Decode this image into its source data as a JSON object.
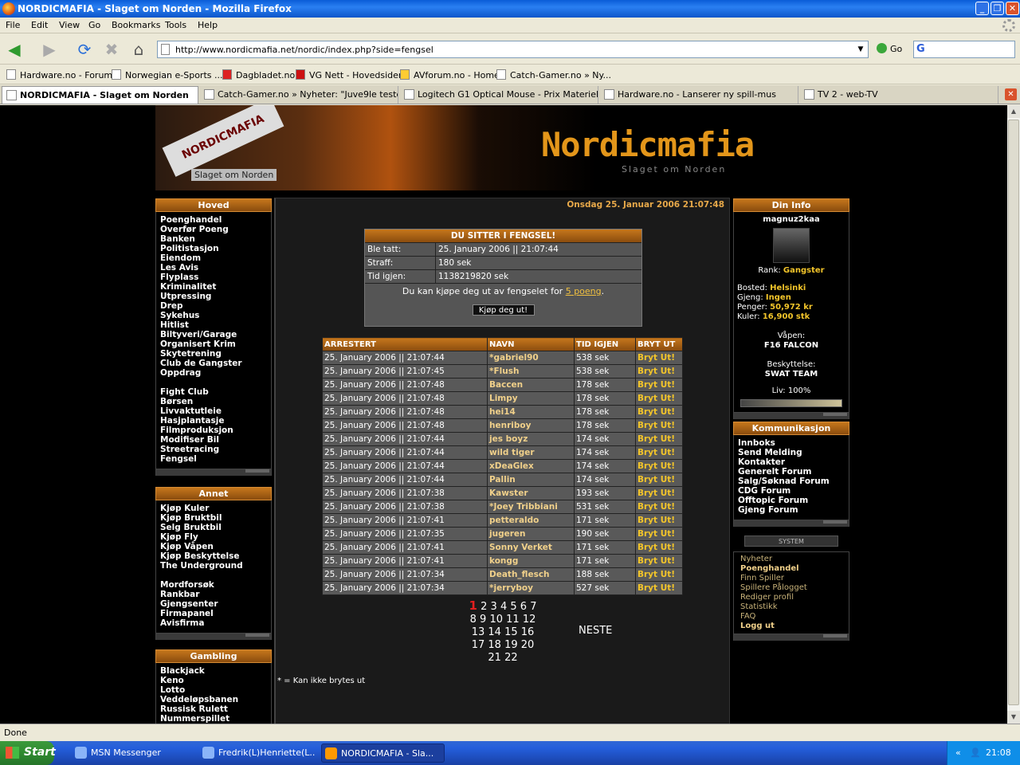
{
  "window": {
    "title": "NORDICMAFIA - Slaget om Norden - Mozilla Firefox"
  },
  "menu": [
    "File",
    "Edit",
    "View",
    "Go",
    "Bookmarks",
    "Tools",
    "Help"
  ],
  "nav": {
    "url": "http://www.nordicmafia.net/nordic/index.php?side=fengsel",
    "go_label": "Go"
  },
  "bookmarks": [
    "Hardware.no - Forum",
    "Norwegian e-Sports ...",
    "Dagbladet.no",
    "VG Nett - Hovedsiden",
    "AVforum.no - Home",
    "Catch-Gamer.no » Ny..."
  ],
  "tabs": [
    "NORDICMAFIA - Slaget om Norden",
    "Catch-Gamer.no » Nyheter: \"Juve9le tester...",
    "Logitech G1 Optical Mouse - Prix Materiel .com",
    "Hardware.no - Lanserer ny spill-mus",
    "TV 2 - web-TV"
  ],
  "status": "Done",
  "taskbar": {
    "start": "Start",
    "tasks": [
      "MSN Messenger",
      "Fredrik(L)Henriette(L...",
      "NORDICMAFIA - Sla..."
    ],
    "clock": "21:08"
  },
  "banner": {
    "ribbon": "NORDICMAFIA",
    "slogan1": "Slaget om Norden",
    "logo": "Nordicmafia",
    "slogan2": "Slaget om Norden"
  },
  "sidebar": {
    "hoved": {
      "title": "Hoved",
      "items1": [
        "Poenghandel",
        "Overfør Poeng",
        "Banken",
        "Politistasjon",
        "Eiendom",
        "Les Avis",
        "Flyplass",
        "Kriminalitet",
        "Utpressing",
        "Drep",
        "Sykehus",
        "Hitlist",
        "Biltyveri/Garage",
        "Organisert Krim",
        "Skytetrening",
        "Club de Gangster",
        "Oppdrag"
      ],
      "items2": [
        "Fight Club",
        "Børsen",
        "Livvaktutleie",
        "Hasjplantasje",
        "Filmproduksjon",
        "Modifiser Bil",
        "Streetracing",
        "Fengsel"
      ]
    },
    "annet": {
      "title": "Annet",
      "items1": [
        "Kjøp Kuler",
        "Kjøp Bruktbil",
        "Selg Bruktbil",
        "Kjøp Fly",
        "Kjøp Våpen",
        "Kjøp Beskyttelse",
        "The Underground"
      ],
      "items2": [
        "Mordforsøk",
        "Rankbar",
        "Gjengsenter",
        "Firmapanel",
        "Avisfirma"
      ]
    },
    "gambling": {
      "title": "Gambling",
      "items": [
        "Blackjack",
        "Keno",
        "Lotto",
        "Veddeløpsbanen",
        "Russisk Rulett",
        "Nummerspillet"
      ]
    }
  },
  "main": {
    "date": "Onsdag 25. Januar 2006 21:07:48",
    "jail": {
      "title": "DU SITTER I FENGSEL!",
      "rows": [
        [
          "Ble tatt:",
          "25. January 2006 || 21:07:44"
        ],
        [
          "Straff:",
          "180 sek"
        ],
        [
          "Tid igjen:",
          "1138219820 sek"
        ]
      ],
      "msg_prefix": "Du kan kjøpe deg ut av fengselet for ",
      "msg_link": "5 poeng",
      "msg_suffix": ".",
      "button": "Kjøp deg ut!"
    },
    "table": {
      "headers": [
        "ARRESTERT",
        "NAVN",
        "TID IGJEN",
        "BRYT UT"
      ],
      "rows": [
        [
          "25. January 2006 || 21:07:44",
          "*gabriel90",
          "538 sek",
          "Bryt Ut!"
        ],
        [
          "25. January 2006 || 21:07:45",
          "*Flush",
          "538 sek",
          "Bryt Ut!"
        ],
        [
          "25. January 2006 || 21:07:48",
          "Baccen",
          "178 sek",
          "Bryt Ut!"
        ],
        [
          "25. January 2006 || 21:07:48",
          "Limpy",
          "178 sek",
          "Bryt Ut!"
        ],
        [
          "25. January 2006 || 21:07:48",
          "hei14",
          "178 sek",
          "Bryt Ut!"
        ],
        [
          "25. January 2006 || 21:07:48",
          "henriboy",
          "178 sek",
          "Bryt Ut!"
        ],
        [
          "25. January 2006 || 21:07:44",
          "jes boyz",
          "174 sek",
          "Bryt Ut!"
        ],
        [
          "25. January 2006 || 21:07:44",
          "wild tiger",
          "174 sek",
          "Bryt Ut!"
        ],
        [
          "25. January 2006 || 21:07:44",
          "xDeaGlex",
          "174 sek",
          "Bryt Ut!"
        ],
        [
          "25. January 2006 || 21:07:44",
          "Pallin",
          "174 sek",
          "Bryt Ut!"
        ],
        [
          "25. January 2006 || 21:07:38",
          "Kawster",
          "193 sek",
          "Bryt Ut!"
        ],
        [
          "25. January 2006 || 21:07:38",
          "*Joey Tribbiani",
          "531 sek",
          "Bryt Ut!"
        ],
        [
          "25. January 2006 || 21:07:41",
          "petteraldo",
          "171 sek",
          "Bryt Ut!"
        ],
        [
          "25. January 2006 || 21:07:35",
          "jugeren",
          "190 sek",
          "Bryt Ut!"
        ],
        [
          "25. January 2006 || 21:07:41",
          "Sonny Verket",
          "171 sek",
          "Bryt Ut!"
        ],
        [
          "25. January 2006 || 21:07:41",
          "kongg",
          "171 sek",
          "Bryt Ut!"
        ],
        [
          "25. January 2006 || 21:07:34",
          "Death_flesch",
          "188 sek",
          "Bryt Ut!"
        ],
        [
          "25. January 2006 || 21:07:34",
          "*jerryboy",
          "527 sek",
          "Bryt Ut!"
        ]
      ]
    },
    "pager": {
      "current": "1",
      "lines": [
        [
          "2",
          "3",
          "4",
          "5",
          "6",
          "7"
        ],
        [
          "8",
          "9",
          "10",
          "11",
          "12"
        ],
        [
          "13",
          "14",
          "15",
          "16"
        ],
        [
          "17",
          "18",
          "19",
          "20"
        ],
        [
          "21",
          "22"
        ]
      ],
      "next": "NESTE"
    },
    "note": "* = Kan ikke brytes ut"
  },
  "info": {
    "title": "Din Info",
    "user": "magnuz2kaa",
    "rank_label": "Rank:",
    "rank": "Gangster",
    "bosted_label": "Bosted:",
    "bosted": "Helsinki",
    "gjeng_label": "Gjeng:",
    "gjeng": "Ingen",
    "penger_label": "Penger:",
    "penger": "50,972 kr",
    "kuler_label": "Kuler:",
    "kuler": "16,900 stk",
    "vapen_label": "Våpen:",
    "vapen": "F16 FALCON",
    "beskyttelse_label": "Beskyttelse:",
    "beskyttelse": "SWAT TEAM",
    "liv_label": "Liv: 100%",
    "liv_fraction": 1.0
  },
  "kommunikasjon": {
    "title": "Kommunikasjon",
    "items": [
      "Innboks",
      "Send Melding",
      "Kontakter",
      "Generelt Forum",
      "Salg/Søknad Forum",
      "CDG Forum",
      "Offtopic Forum",
      "Gjeng Forum"
    ]
  },
  "system": {
    "title": "SYSTEM",
    "items": [
      "Nyheter",
      "Poenghandel",
      "Finn Spiller",
      "Spillere Pålogget",
      "Rediger profil",
      "Statistikk",
      "FAQ",
      "Logg ut"
    ]
  }
}
